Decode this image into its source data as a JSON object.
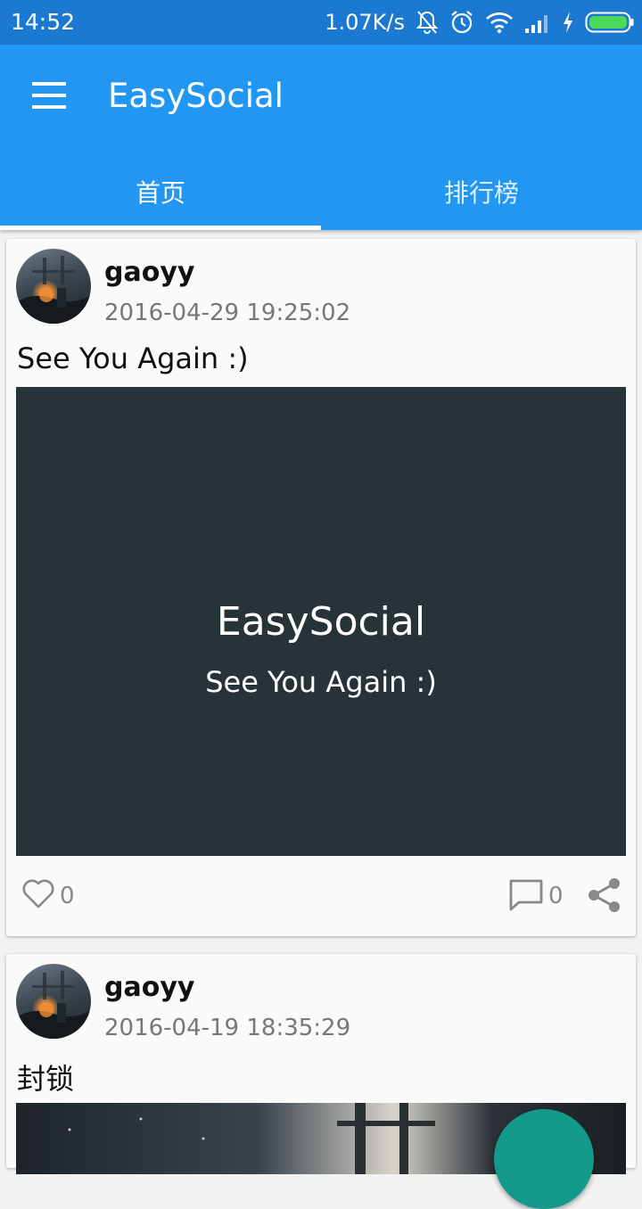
{
  "status_bar": {
    "time": "14:52",
    "network_speed": "1.07K/s",
    "icons": [
      "notifications-off-icon",
      "alarm-icon",
      "wifi-icon",
      "signal-icon",
      "charging-icon",
      "battery-icon"
    ]
  },
  "app_bar": {
    "title": "EasySocial",
    "menu_icon": "menu-icon",
    "color": "#2196f3"
  },
  "tabs": [
    {
      "label": "首页",
      "selected": true
    },
    {
      "label": "排行榜",
      "selected": false
    }
  ],
  "posts": [
    {
      "username": "gaoyy",
      "timestamp": "2016-04-29 19:25:02",
      "text": "See You Again :)",
      "image_title": "EasySocial",
      "image_subtitle": "See You Again :)",
      "likes": "0",
      "comments": "0"
    },
    {
      "username": "gaoyy",
      "timestamp": "2016-04-19 18:35:29",
      "text": "封锁"
    }
  ],
  "fab_color": "#149a8b"
}
